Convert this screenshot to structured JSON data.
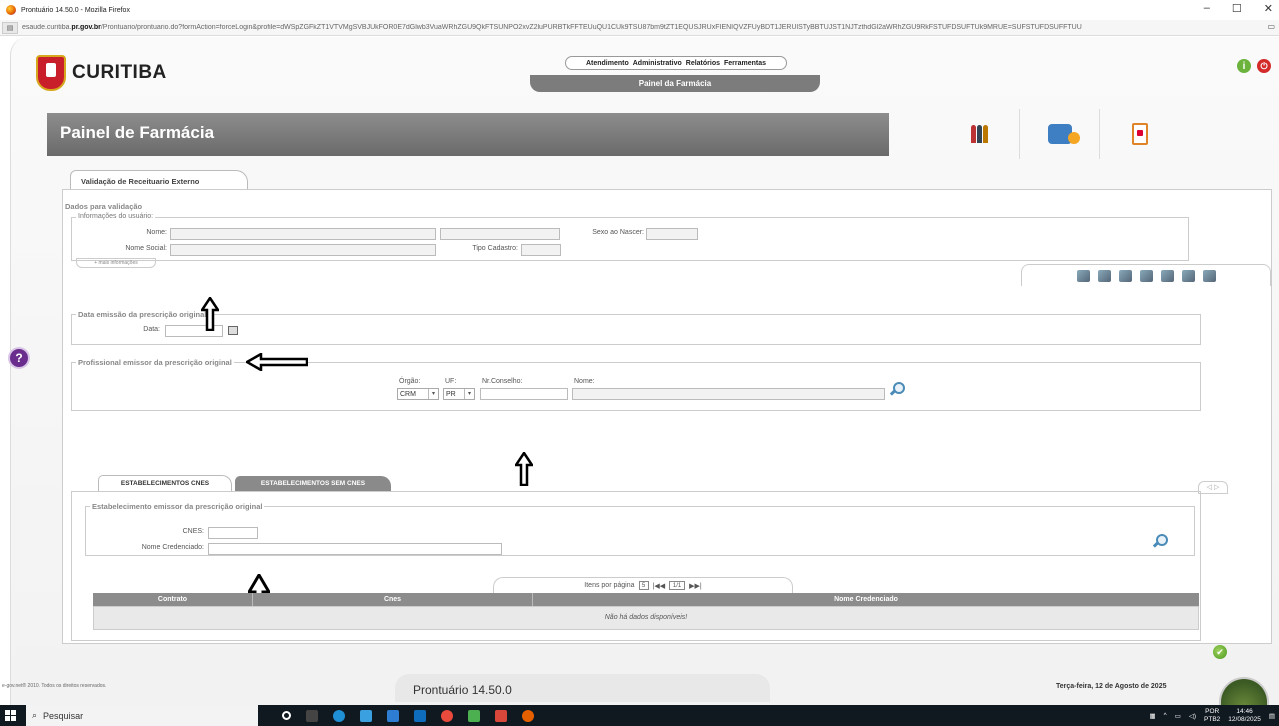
{
  "browser": {
    "window_title": "Prontuário 14.50.0 - Mozilla Firefox",
    "url_prefix": "esaude.curitiba.",
    "url_domain": "pr.gov.br",
    "url_rest": "/Prontuario/prontuario.do?formAction=forceLogin&profile=dWSpZGFkZT1VTVMgSVBJUkFOR0E7dGlwb3VuaWRhZGU9QkFTSUNPO2xvZ2luPURBTkFFTEUuQU1CUk9TSU87bm9tZT1EQUSJRUxFIENIQVZFUyBDT1JERUlSTyBBTUJST1NJTzthdGl2aWRhZGU9RkFSTUFDSUFTUk9MRUE=SUFSTUFDSUFFTUU",
    "minimize": "–",
    "maximize": "☐",
    "close": "✕"
  },
  "app": {
    "logo_text": "CURITIBA",
    "top_menu": [
      "Atendimento",
      "Administrativo",
      "Relatórios",
      "Ferramentas"
    ],
    "painel_tab": "Painel da Farmácia",
    "header_title": "Painel de Farmácia",
    "help_label": "?",
    "info_label": "i",
    "power_label": "⏻"
  },
  "main_tab": "Validação de Receituario Externo",
  "form": {
    "section_legend": "Dados para validação",
    "user_info_legend": "Informações do usuário:",
    "nome_label": "Nome:",
    "nome_social_label": "Nome Social:",
    "sexo_label": "Sexo ao Nascer:",
    "tipo_cadastro_label": "Tipo Cadastro:",
    "mais_info": "+ mais informações",
    "data_emissao_legend": "Data emissão da prescrição original",
    "data_label": "Data:",
    "profissional_legend": "Profissional emissor da prescrição original",
    "orgao_label": "Órgão:",
    "orgao_value": "CRM",
    "uf_label": "UF:",
    "uf_value": "PR",
    "nr_conselho_label": "Nr.Conselho:",
    "nome_prof_label": "Nome:"
  },
  "subtabs": [
    "ESTABELECIMENTOS CNES",
    "ESTABELECIMENTOS SEM CNES"
  ],
  "nav_arrows": "◁ ▷",
  "estab": {
    "legend": "Estabelecimento emissor da prescrição original",
    "cnes_label": "CNES:",
    "nome_credenciado_label": "Nome Credenciado:",
    "pager_label": "Itens por página",
    "pager_size": "5",
    "pager_pages": "1/1",
    "columns": [
      "Contrato",
      "Cnes",
      "Nome Credenciado"
    ],
    "empty_message": "Não há dados disponíveis!"
  },
  "footer": {
    "copyright": "e-gov.net® 2010. Todos os direitos reservados.",
    "version": "Prontuário 14.50.0",
    "date": "Terça-feira, 12 de Agosto de 2025"
  },
  "taskbar": {
    "search_placeholder": "Pesquisar",
    "lang": "POR",
    "lang_sub": "PTB2",
    "time": "14:46",
    "date": "12/08/2025"
  },
  "colors": {
    "header_bar": "#7a7a7a",
    "help_purple": "#6a2d8e",
    "ok_green": "#6cb33e",
    "power_red": "#d32a2a"
  }
}
